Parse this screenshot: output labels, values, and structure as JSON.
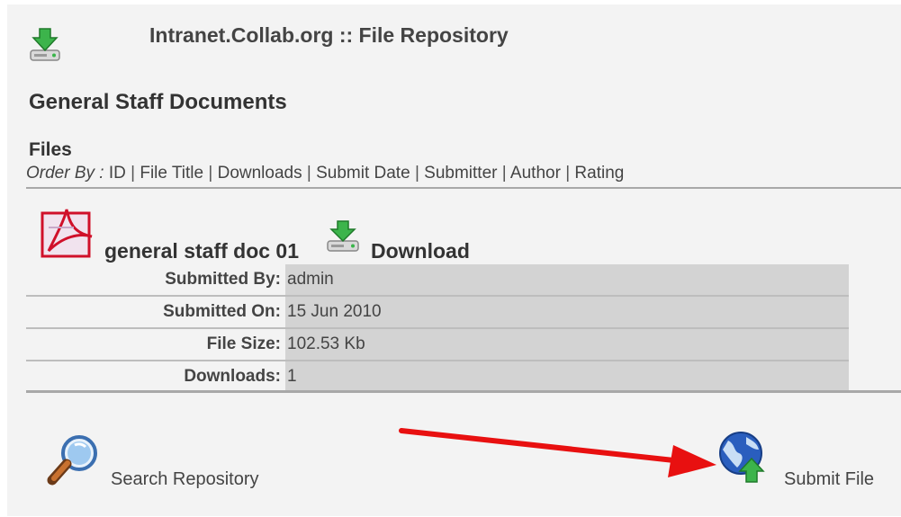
{
  "header": {
    "title": "Intranet.Collab.org :: File Repository"
  },
  "section": {
    "title": "General Staff Documents"
  },
  "files": {
    "heading": "Files",
    "order_by_label": "Order By :",
    "order_by_options": [
      "ID",
      "File Title",
      "Downloads",
      "Submit Date",
      "Submitter",
      "Author",
      "Rating"
    ]
  },
  "file": {
    "title": "general staff doc 01",
    "download_label": "Download",
    "details": [
      {
        "label": "Submitted By:",
        "value": "admin"
      },
      {
        "label": "Submitted On:",
        "value": "15 Jun 2010"
      },
      {
        "label": "File Size:",
        "value": "102.53 Kb"
      },
      {
        "label": "Downloads:",
        "value": "1"
      }
    ]
  },
  "footer": {
    "search_label": "Search Repository",
    "submit_label": "Submit File"
  },
  "colors": {
    "background": "#f3f3f3",
    "value_cell": "#d3d3d3",
    "annotation_arrow": "#e81010"
  }
}
